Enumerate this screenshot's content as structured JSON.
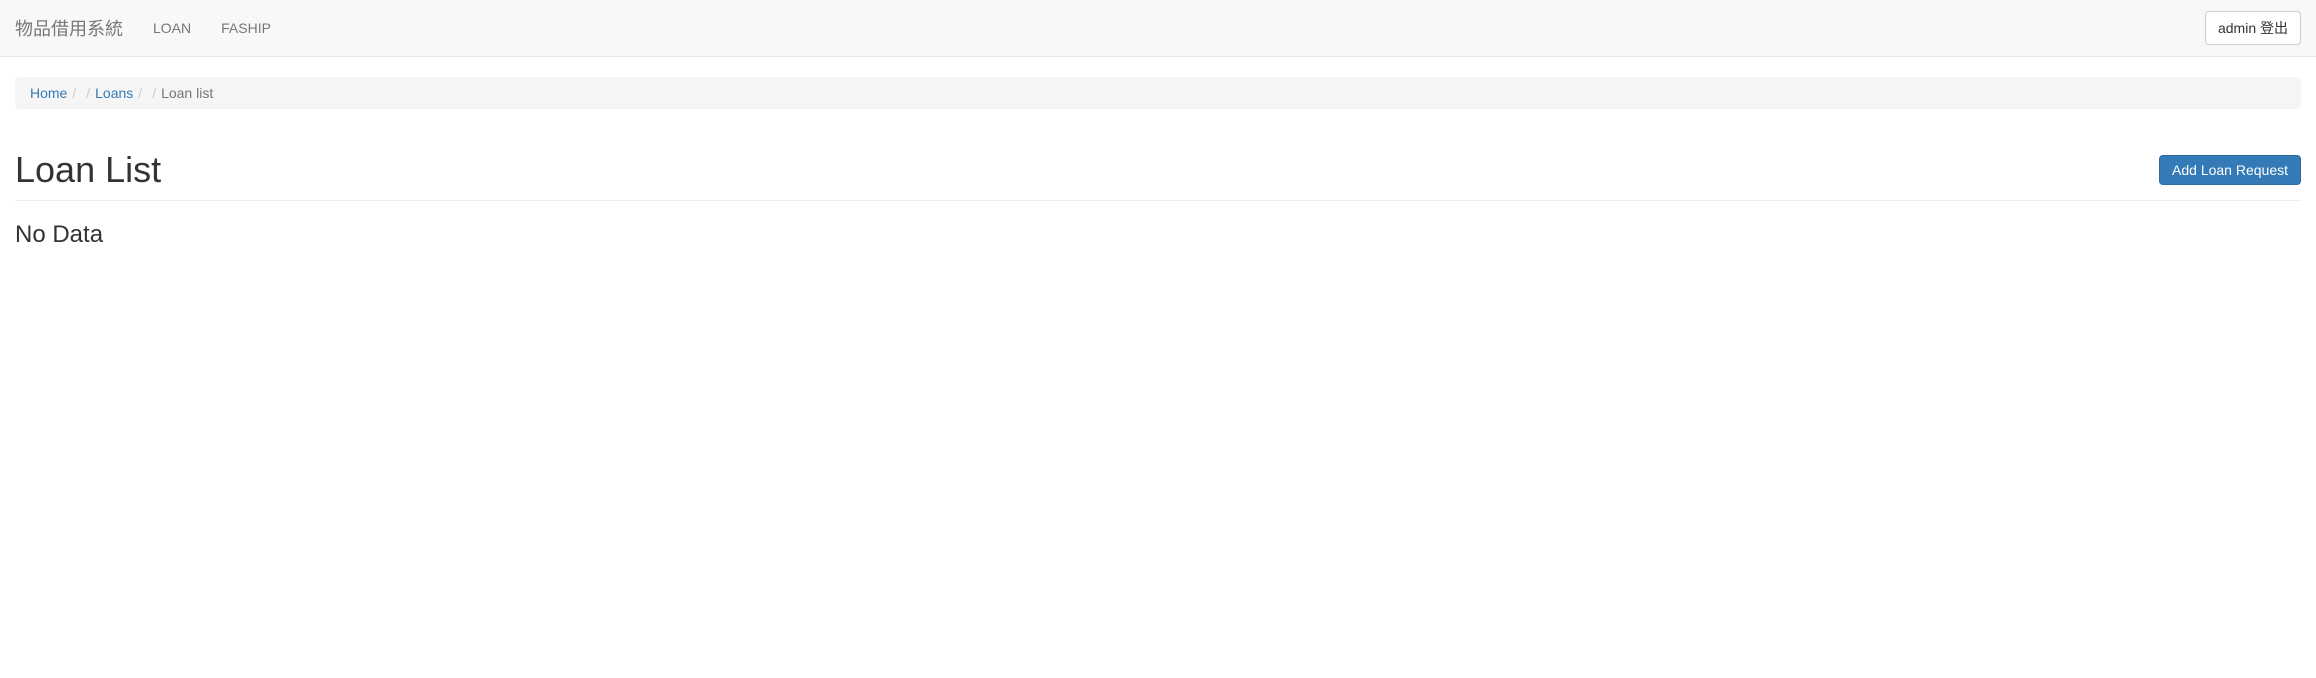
{
  "navbar": {
    "brand": "物品借用系統",
    "links": [
      {
        "label": "LOAN"
      },
      {
        "label": "FASHIP"
      }
    ],
    "logout_label": "admin 登出"
  },
  "breadcrumb": {
    "items": [
      {
        "label": "Home",
        "link": true
      },
      {
        "label": "Loans",
        "link": true
      },
      {
        "label": "Loan list",
        "link": false
      }
    ]
  },
  "page": {
    "title": "Loan List",
    "add_button_label": "Add Loan Request",
    "empty_message": "No Data"
  }
}
